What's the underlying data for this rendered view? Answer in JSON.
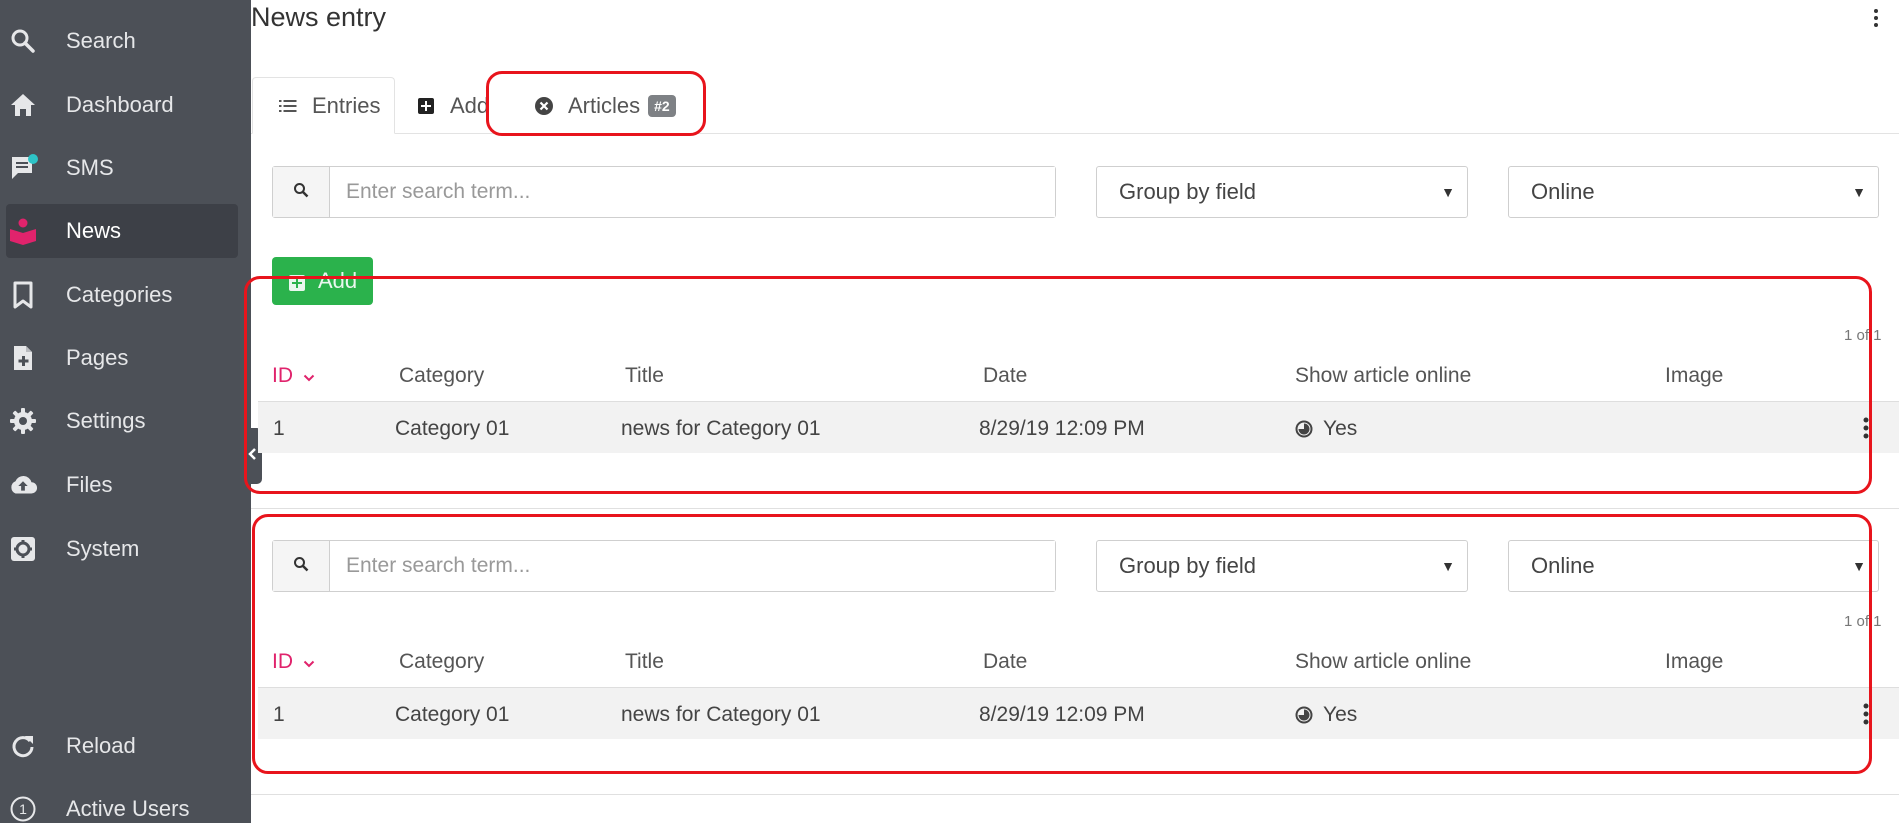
{
  "sidebar": {
    "items": [
      {
        "label": "Search",
        "icon": "search-icon"
      },
      {
        "label": "Dashboard",
        "icon": "home-icon"
      },
      {
        "label": "SMS",
        "icon": "chat-icon"
      },
      {
        "label": "News",
        "icon": "news-reader-icon"
      },
      {
        "label": "Categories",
        "icon": "bookmark-icon"
      },
      {
        "label": "Pages",
        "icon": "file-plus-icon"
      },
      {
        "label": "Settings",
        "icon": "gear-icon"
      },
      {
        "label": "Files",
        "icon": "cloud-upload-icon"
      },
      {
        "label": "System",
        "icon": "settings-box-icon"
      }
    ],
    "bottom_items": [
      {
        "label": "Reload",
        "icon": "reload-icon"
      },
      {
        "label": "Active Users",
        "icon": "user-count-icon",
        "count": "1"
      }
    ],
    "active": "News"
  },
  "header": {
    "title": "News entry"
  },
  "tabs": [
    {
      "label": "Entries",
      "icon": "list-icon"
    },
    {
      "label": "Add",
      "icon": "plus-square-icon"
    },
    {
      "label": "Articles",
      "icon": "close-circle-icon",
      "badge": "#2"
    }
  ],
  "panels": [
    {
      "search_placeholder": "Enter search term...",
      "group_by": "Group by field",
      "status_filter": "Online",
      "add_label": "Add",
      "pager": "1 of 1",
      "columns": [
        "ID",
        "Category",
        "Title",
        "Date",
        "Show article online",
        "Image"
      ],
      "rows": [
        {
          "id": "1",
          "category": "Category 01",
          "title": "news for Category 01",
          "date": "8/29/19 12:09 PM",
          "online": "Yes"
        }
      ]
    },
    {
      "search_placeholder": "Enter search term...",
      "group_by": "Group by field",
      "status_filter": "Online",
      "pager": "1 of 1",
      "columns": [
        "ID",
        "Category",
        "Title",
        "Date",
        "Show article online",
        "Image"
      ],
      "rows": [
        {
          "id": "1",
          "category": "Category 01",
          "title": "news for Category 01",
          "date": "8/29/19 12:09 PM",
          "online": "Yes"
        }
      ]
    }
  ],
  "colors": {
    "sidebar_bg": "#4c5057",
    "accent": "#e0236c",
    "add_button": "#2bb24c",
    "annotation": "#e8141c",
    "sms_dot": "#2ec4c7"
  }
}
